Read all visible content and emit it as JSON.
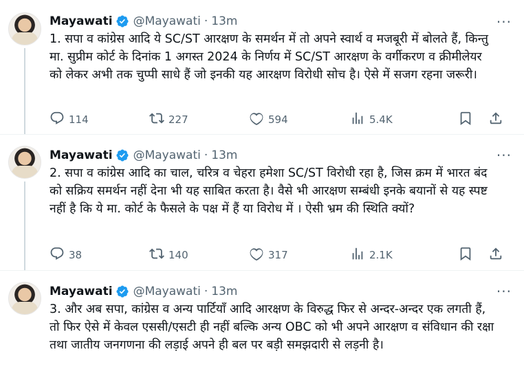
{
  "author": {
    "name": "Mayawati",
    "handle": "@Mayawati",
    "time": "13m"
  },
  "tweets": [
    {
      "text": "1. सपा व कांग्रेस आदि ये SC/ST आरक्षण के समर्थन में तो अपने स्वार्थ व मजबूरी में बोलते हैं, किन्तु मा. सुप्रीम कोर्ट के दिनांक 1 अगस्त 2024 के निर्णय में SC/ST आरक्षण के वर्गीकरण व क्रीमीलेयर को लेकर अभी तक चुप्पी साधे हैं जो इनकी यह आरक्षण विरोधी सोच है। ऐसे में सजग रहना जरूरी।",
      "replies": "114",
      "reposts": "227",
      "likes": "594",
      "views": "5.4K"
    },
    {
      "text": "2. सपा व कांग्रेस आदि का चाल, चरित्र व चेहरा हमेशा SC/ST विरोधी रहा है, जिस क्रम में भारत बंद को सक्रिय समर्थन नहीं देना भी यह साबित करता है। वैसे भी आरक्षण सम्बंधी इनके बयानों से यह स्पष्ट नहीं है कि ये मा. कोर्ट के फैसले के पक्ष में हैं या विरोध में । ऐसी भ्रम की स्थिति क्यों?",
      "replies": "38",
      "reposts": "140",
      "likes": "317",
      "views": "2.1K"
    },
    {
      "text": "3. और अब सपा, कांग्रेस व अन्य पार्टियाँ आदि आरक्षण के विरुद्ध फिर से अन्दर-अन्दर एक लगती हैं, तो फिर ऐसे में केवल एससी/एसटी ही नहीं बल्कि अन्य OBC को भी अपने आरक्षण व संविधान की रक्षा तथा जातीय जनगणना की लड़ाई अपने ही बल पर बड़ी समझदारी से लड़नी है।"
    }
  ],
  "icons": {
    "verified": "verified-badge-icon",
    "more": "more-icon",
    "reply": "reply-icon",
    "repost": "repost-icon",
    "like": "like-icon",
    "views": "views-icon",
    "bookmark": "bookmark-icon",
    "share": "share-icon"
  },
  "colors": {
    "verified": "#1d9bf0",
    "muted": "#536471",
    "text": "#0f1419",
    "divider": "#eff3f4"
  }
}
